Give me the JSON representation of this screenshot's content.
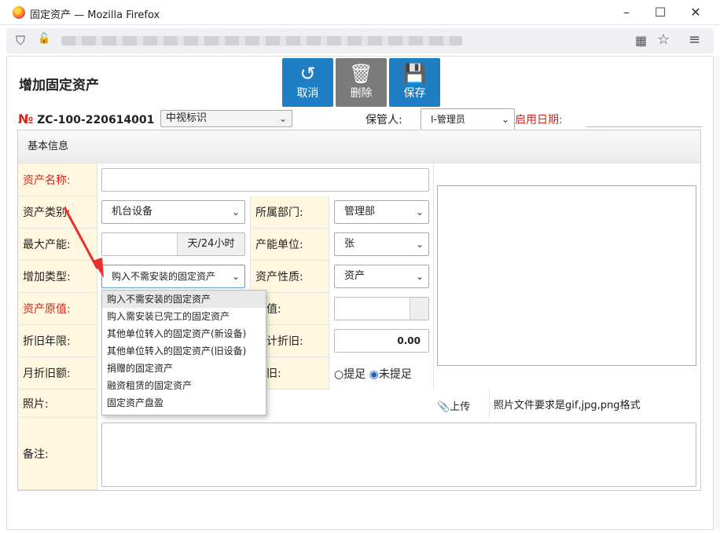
{
  "window": {
    "title": "固定资产 — Mozilla Firefox",
    "min": "–",
    "max": "☐",
    "close": "✕"
  },
  "browser": {
    "shield": "⛉",
    "lock": "🔓",
    "qr": "▦",
    "star": "☆",
    "menu": "≡"
  },
  "page": {
    "heading": "增加固定资产",
    "buttons": {
      "cancel": {
        "icon": "↺",
        "label": "取消"
      },
      "delete": {
        "icon": "🗑",
        "label": "删除"
      },
      "save": {
        "icon": "💾",
        "label": "保存"
      }
    },
    "asset_no_prefix": "№",
    "asset_no": "ZC-100-220614001",
    "brand_select": "中视标识",
    "keeper_label": "保管人:",
    "keeper_value": "ⵏ-管理员",
    "start_date_label": "启用日期:",
    "start_date_value": ""
  },
  "panel": {
    "title": "基本信息",
    "asset_name_label": "资产名称:",
    "asset_name_value": "",
    "category_label": "资产类别:",
    "category_value": "机台设备",
    "dept_label": "所属部门:",
    "dept_value": "管理部",
    "max_capacity_label": "最大产能:",
    "max_capacity_value": "",
    "max_capacity_suffix": "天/24小时",
    "capacity_unit_label": "产能单位:",
    "capacity_unit_value": "张",
    "add_type_label": "增加类型:",
    "add_type_value": "购入不需安装的固定资产",
    "nature_label": "资产性质:",
    "nature_value": "资产",
    "original_value_label": "资产原值:",
    "net_value_label": "值:",
    "depr_years_label": "折旧年限:",
    "accum_depr_label": "计折旧:",
    "accum_depr_value": "0.00",
    "monthly_depr_label": "月折旧额:",
    "depr_flag_label": "旧:",
    "opt_provided": "提足",
    "opt_not_provided": "未提足",
    "photo_label": "照片:",
    "upload_label": "上传",
    "photo_hint": "照片文件要求是gif,jpg,png格式",
    "remark_label": "备注:",
    "remark_value": ""
  },
  "dropdown_options": [
    "购入不需安装的固定资产",
    "购入需安装已完工的固定资产",
    "其他单位转入的固定资产(新设备)",
    "其他单位转入的固定资产(旧设备)",
    "捐赠的固定资产",
    "融资租赁的固定资产",
    "固定资产盘盈"
  ],
  "colors": {
    "primary_button": "#1f7fc4",
    "delete_button": "#7b7b7b",
    "required_label": "#d9241c",
    "label_bg": "#fff7e0"
  }
}
